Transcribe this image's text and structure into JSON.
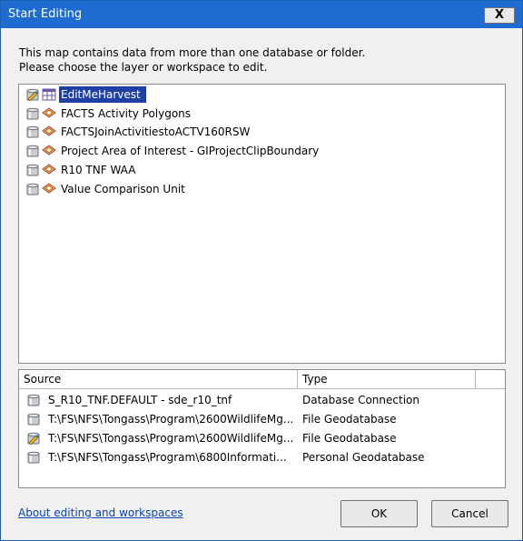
{
  "window": {
    "title": "Start Editing",
    "close_glyph": "X"
  },
  "message": {
    "line1": "This map contains data from more than one database or folder.",
    "line2": "Please choose the layer or workspace to edit."
  },
  "layers": [
    {
      "label": "EditMeHarvest",
      "selected": true,
      "icon": "table-icon"
    },
    {
      "label": "FACTS Activity Polygons",
      "selected": false,
      "icon": "layer-icon"
    },
    {
      "label": "FACTSJoinActivitiestoACTV160RSW",
      "selected": false,
      "icon": "layer-icon"
    },
    {
      "label": "Project Area of Interest - GIProjectClipBoundary",
      "selected": false,
      "icon": "layer-icon"
    },
    {
      "label": "R10 TNF WAA",
      "selected": false,
      "icon": "layer-icon"
    },
    {
      "label": "Value Comparison Unit",
      "selected": false,
      "icon": "layer-icon"
    }
  ],
  "workspaces": {
    "headers": {
      "source": "Source",
      "type": "Type"
    },
    "rows": [
      {
        "source": "S_R10_TNF.DEFAULT - sde_r10_tnf",
        "type": "Database Connection",
        "icon": "database-icon"
      },
      {
        "source": "T:\\FS\\NFS\\Tongass\\Program\\2600WildlifeMg...",
        "type": "File Geodatabase",
        "icon": "database-icon"
      },
      {
        "source": "T:\\FS\\NFS\\Tongass\\Program\\2600WildlifeMg...",
        "type": "File Geodatabase",
        "icon": "edit-database-icon"
      },
      {
        "source": "T:\\FS\\NFS\\Tongass\\Program\\6800Informati...",
        "type": "Personal Geodatabase",
        "icon": "database-icon"
      }
    ]
  },
  "footer": {
    "link": "About editing and workspaces",
    "ok": "OK",
    "cancel": "Cancel"
  }
}
